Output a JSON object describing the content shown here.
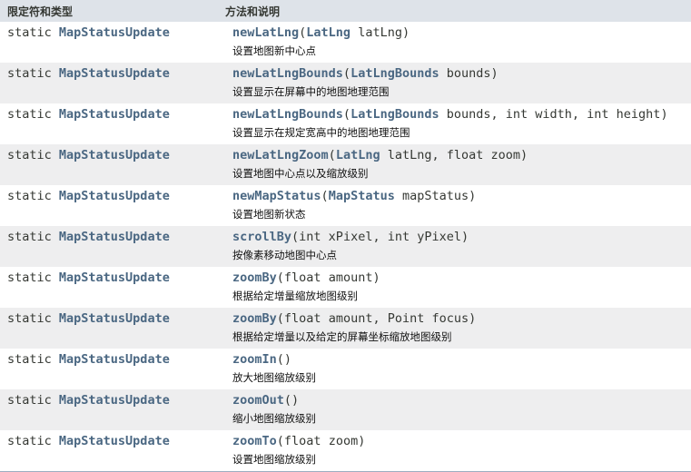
{
  "header": {
    "col_type": "限定符和类型",
    "col_method": "方法和说明"
  },
  "rows": [
    {
      "modifier": "static ",
      "type": "MapStatusUpdate",
      "method": "newLatLng",
      "open": "(",
      "ptype": "LatLng",
      "params": " latLng)",
      "desc": "设置地图新中心点"
    },
    {
      "modifier": "static ",
      "type": "MapStatusUpdate",
      "method": "newLatLngBounds",
      "open": "(",
      "ptype": "LatLngBounds",
      "params": " bounds)",
      "desc": "设置显示在屏幕中的地图地理范围"
    },
    {
      "modifier": "static ",
      "type": "MapStatusUpdate",
      "method": "newLatLngBounds",
      "open": "(",
      "ptype": "LatLngBounds",
      "params": " bounds, int width, int height)",
      "desc": "设置显示在规定宽高中的地图地理范围"
    },
    {
      "modifier": "static ",
      "type": "MapStatusUpdate",
      "method": "newLatLngZoom",
      "open": "(",
      "ptype": "LatLng",
      "params": " latLng, float zoom)",
      "desc": "设置地图中心点以及缩放级别"
    },
    {
      "modifier": "static ",
      "type": "MapStatusUpdate",
      "method": "newMapStatus",
      "open": "(",
      "ptype": "MapStatus",
      "params": " mapStatus)",
      "desc": "设置地图新状态"
    },
    {
      "modifier": "static ",
      "type": "MapStatusUpdate",
      "method": "scrollBy",
      "open": "(",
      "ptype": "",
      "params": "int xPixel, int yPixel)",
      "desc": "按像素移动地图中心点"
    },
    {
      "modifier": "static ",
      "type": "MapStatusUpdate",
      "method": "zoomBy",
      "open": "(",
      "ptype": "",
      "params": "float amount)",
      "desc": "根据给定增量缩放地图级别"
    },
    {
      "modifier": "static ",
      "type": "MapStatusUpdate",
      "method": "zoomBy",
      "open": "(",
      "ptype": "",
      "params": "float amount, Point focus)",
      "desc": "根据给定增量以及给定的屏幕坐标缩放地图级别"
    },
    {
      "modifier": "static ",
      "type": "MapStatusUpdate",
      "method": "zoomIn",
      "open": "(",
      "ptype": "",
      "params": ")",
      "desc": "放大地图缩放级别"
    },
    {
      "modifier": "static ",
      "type": "MapStatusUpdate",
      "method": "zoomOut",
      "open": "(",
      "ptype": "",
      "params": ")",
      "desc": "缩小地图缩放级别"
    },
    {
      "modifier": "static ",
      "type": "MapStatusUpdate",
      "method": "zoomTo",
      "open": "(",
      "ptype": "",
      "params": "float zoom)",
      "desc": "设置地图缩放级别"
    }
  ]
}
